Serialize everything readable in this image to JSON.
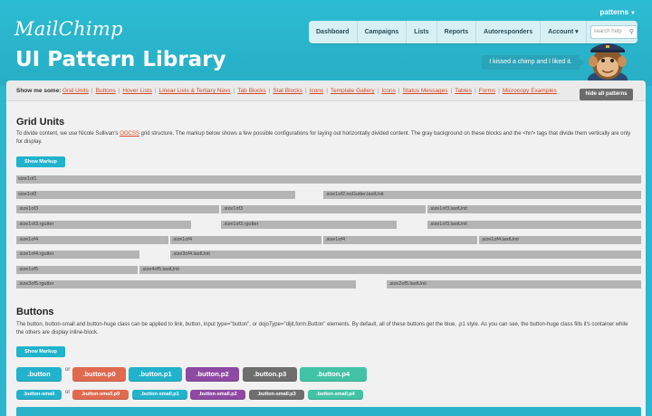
{
  "header": {
    "logo": "MailChimp",
    "title": "UI Pattern Library",
    "user": "patterns",
    "nav": [
      "Dashboard",
      "Campaigns",
      "Lists",
      "Reports",
      "Autoresponders",
      "Account"
    ],
    "account_caret": "▾",
    "search_placeholder": "search help",
    "bubble_text": "I kissed a chimp and I liked it."
  },
  "toolbar": {
    "label": "Show me some:",
    "links": [
      "Grid Units",
      "Buttons",
      "Hover Lists",
      "Linear Lists & Tertiary Navs",
      "Tab Blocks",
      "Stat Blocks",
      "Icons",
      "Template Gallery",
      "Icons",
      "Status Messages",
      "Tables",
      "Forms",
      "Microcopy Examples"
    ],
    "hide_label": "hide all patterns"
  },
  "grid_section": {
    "title": "Grid Units",
    "desc_before": "To divide content, we use Nicole Sullivan's ",
    "desc_link": "OOCSS",
    "desc_after": " grid structure. The markup below shows a few possible configurations for laying out horizontally divided content. The gray background on these blocks and the <hr/> tags that divide them vertically are only for display.",
    "show_markup": "Show Markup",
    "rows": [
      [
        "size1of1"
      ],
      [
        "size1of2",
        ".size1of2.noGutter.lastUnit"
      ],
      [
        ".size1of3",
        ".size1of3",
        ".size1of3.lastUnit"
      ],
      [
        ".size1of3.rgutter",
        ".size1of3.rgutter",
        ".size1of3.lastUnit"
      ],
      [
        ".size1of4",
        ".size1of4",
        ".size1of4",
        ".size1of4.lastUnit"
      ],
      [
        ".size1of4.rgutter",
        ".size3of4.lastUnit"
      ],
      [
        ".size1of5",
        ".size4of5.lastUnit"
      ],
      [
        ".size3of5.rgutter",
        ".size2of5.lastUnit"
      ]
    ]
  },
  "buttons_section": {
    "title": "Buttons",
    "desc": "The button, button-small and button-huge class can be applied to link, button, input type=\"button\", or dojoType=\"dijit.form.Button\" elements. By default, all of these buttons get the blue, .p1 style. As you can see, the button-huge class fills it's container while the others are display inline-block.",
    "show_markup": "Show Markup",
    "or": "or",
    "large": [
      ".button",
      ".button.p0",
      ".button.p1",
      ".button.p2",
      ".button.p3",
      ".button.p4"
    ],
    "small": [
      ".button-small",
      ".button-small.p0",
      ".button-small.p1",
      ".button-small.p2",
      ".button-small.p3",
      ".button-small.p4"
    ],
    "colors": [
      "#23b2cb",
      "#e06a50",
      "#23b2cb",
      "#8e4aa3",
      "#6e6e6e",
      "#43c3a5"
    ]
  }
}
